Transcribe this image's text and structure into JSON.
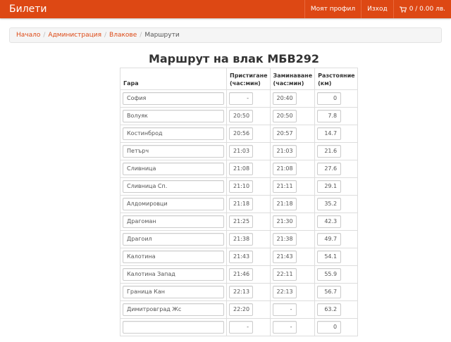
{
  "navbar": {
    "brand": "Билети",
    "profile": "Моят профил",
    "logout": "Изход",
    "cart": "0 / 0.00 лв.",
    "cart_icon": "cart-icon"
  },
  "breadcrumb": {
    "items": [
      "Начало",
      "Администрация",
      "Влакове"
    ],
    "active": "Маршрути",
    "separator": "/"
  },
  "page": {
    "title": "Маршрут на влак МБВ292"
  },
  "table": {
    "headers": {
      "station": "Гара",
      "arrival_line1": "Пристигане",
      "arrival_line2": "(час:мин)",
      "departure_line1": "Заминаване",
      "departure_line2": "(час:мин)",
      "distance_line1": "Разстояние",
      "distance_line2": "(км)"
    },
    "rows": [
      {
        "station": "София",
        "arrival": "-",
        "departure": "20:40",
        "distance": "0"
      },
      {
        "station": "Волуяк",
        "arrival": "20:50",
        "departure": "20:50",
        "distance": "7.8"
      },
      {
        "station": "Костинброд",
        "arrival": "20:56",
        "departure": "20:57",
        "distance": "14.7"
      },
      {
        "station": "Петърч",
        "arrival": "21:03",
        "departure": "21:03",
        "distance": "21.6"
      },
      {
        "station": "Сливница",
        "arrival": "21:08",
        "departure": "21:08",
        "distance": "27.6"
      },
      {
        "station": "Сливница Сп.",
        "arrival": "21:10",
        "departure": "21:11",
        "distance": "29.1"
      },
      {
        "station": "Алдомировци",
        "arrival": "21:18",
        "departure": "21:18",
        "distance": "35.2"
      },
      {
        "station": "Драгоман",
        "arrival": "21:25",
        "departure": "21:30",
        "distance": "42.3"
      },
      {
        "station": "Драгоил",
        "arrival": "21:38",
        "departure": "21:38",
        "distance": "49.7"
      },
      {
        "station": "Калотина",
        "arrival": "21:43",
        "departure": "21:43",
        "distance": "54.1"
      },
      {
        "station": "Калотина Запад",
        "arrival": "21:46",
        "departure": "22:11",
        "distance": "55.9"
      },
      {
        "station": "Граница Кан",
        "arrival": "22:13",
        "departure": "22:13",
        "distance": "56.7"
      },
      {
        "station": "Димитровград Жс",
        "arrival": "22:20",
        "departure": "-",
        "distance": "63.2"
      },
      {
        "station": "",
        "arrival": "-",
        "departure": "-",
        "distance": "0"
      }
    ]
  },
  "colors": {
    "navbar": "#dd4814",
    "link": "#dd4814"
  }
}
